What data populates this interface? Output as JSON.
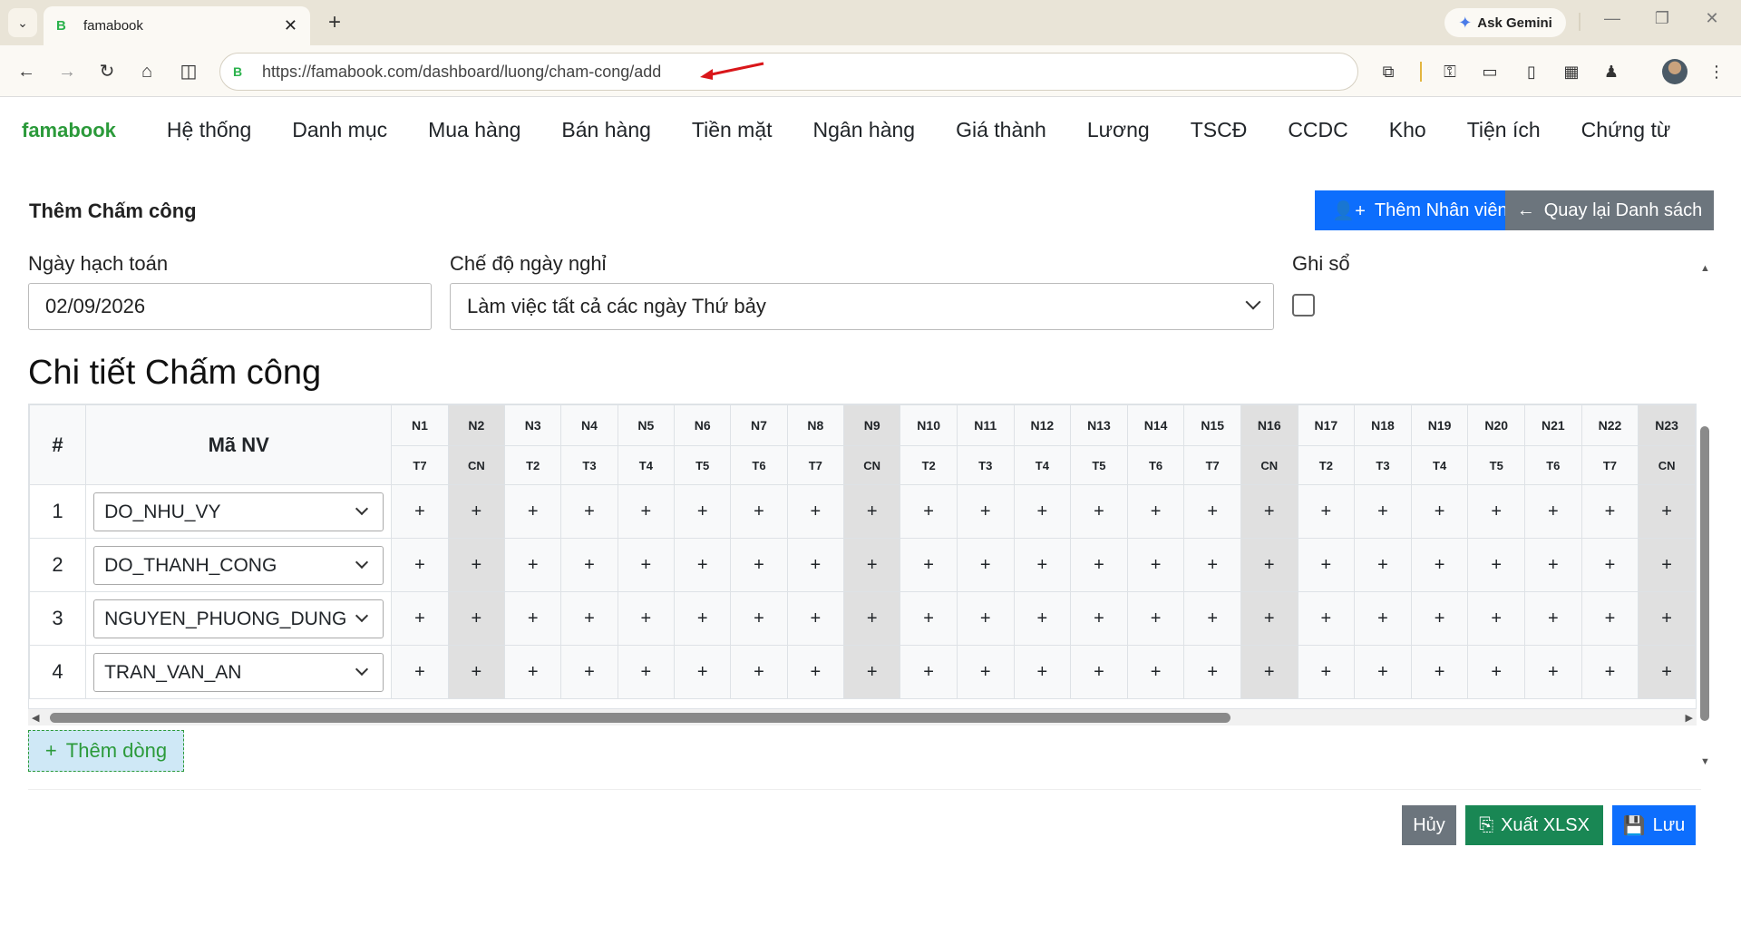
{
  "browser": {
    "tab_title": "famabook",
    "tab_favicon": "B",
    "url": "https://famabook.com/dashboard/luong/cham-cong/add",
    "gemini_label": "Ask Gemini"
  },
  "app": {
    "brand": "famabook",
    "menu": [
      "Hệ thống",
      "Danh mục",
      "Mua hàng",
      "Bán hàng",
      "Tiền mặt",
      "Ngân hàng",
      "Giá thành",
      "Lương",
      "TSCĐ",
      "CCDC",
      "Kho",
      "Tiện ích",
      "Chứng từ"
    ]
  },
  "page": {
    "title": "Thêm Chấm công",
    "add_employee_button": "Thêm Nhân viên",
    "back_button": "Quay lại Danh sách"
  },
  "form": {
    "date_label": "Ngày hạch toán",
    "date_value": "02/09/2026",
    "mode_label": "Chế độ ngày nghỉ",
    "mode_value": "Làm việc tất cả các ngày Thứ bảy",
    "post_label": "Ghi sổ",
    "post_checked": false
  },
  "section_title": "Chi tiết Chấm công",
  "table": {
    "col_index": "#",
    "col_employee": "Mã NV",
    "days": [
      {
        "n": "N1",
        "d": "T7",
        "off": false
      },
      {
        "n": "N2",
        "d": "CN",
        "off": true
      },
      {
        "n": "N3",
        "d": "T2",
        "off": false
      },
      {
        "n": "N4",
        "d": "T3",
        "off": false
      },
      {
        "n": "N5",
        "d": "T4",
        "off": false
      },
      {
        "n": "N6",
        "d": "T5",
        "off": false
      },
      {
        "n": "N7",
        "d": "T6",
        "off": false
      },
      {
        "n": "N8",
        "d": "T7",
        "off": false
      },
      {
        "n": "N9",
        "d": "CN",
        "off": true
      },
      {
        "n": "N10",
        "d": "T2",
        "off": false
      },
      {
        "n": "N11",
        "d": "T3",
        "off": false
      },
      {
        "n": "N12",
        "d": "T4",
        "off": false
      },
      {
        "n": "N13",
        "d": "T5",
        "off": false
      },
      {
        "n": "N14",
        "d": "T6",
        "off": false
      },
      {
        "n": "N15",
        "d": "T7",
        "off": false
      },
      {
        "n": "N16",
        "d": "CN",
        "off": true
      },
      {
        "n": "N17",
        "d": "T2",
        "off": false
      },
      {
        "n": "N18",
        "d": "T3",
        "off": false
      },
      {
        "n": "N19",
        "d": "T4",
        "off": false
      },
      {
        "n": "N20",
        "d": "T5",
        "off": false
      },
      {
        "n": "N21",
        "d": "T6",
        "off": false
      },
      {
        "n": "N22",
        "d": "T7",
        "off": false
      },
      {
        "n": "N23",
        "d": "CN",
        "off": true
      }
    ],
    "cell_symbol": "+",
    "rows": [
      {
        "index": "1",
        "employee": "DO_NHU_VY"
      },
      {
        "index": "2",
        "employee": "DO_THANH_CONG"
      },
      {
        "index": "3",
        "employee": "NGUYEN_PHUONG_DUNG"
      },
      {
        "index": "4",
        "employee": "TRAN_VAN_AN"
      }
    ]
  },
  "add_row_button": "Thêm dòng",
  "footer": {
    "cancel": "Hủy",
    "export": "Xuất XLSX",
    "save": "Lưu"
  },
  "colors": {
    "brand": "#2b9a3a",
    "primary": "#0d6efd",
    "secondary": "#6c757d",
    "success": "#198754"
  }
}
